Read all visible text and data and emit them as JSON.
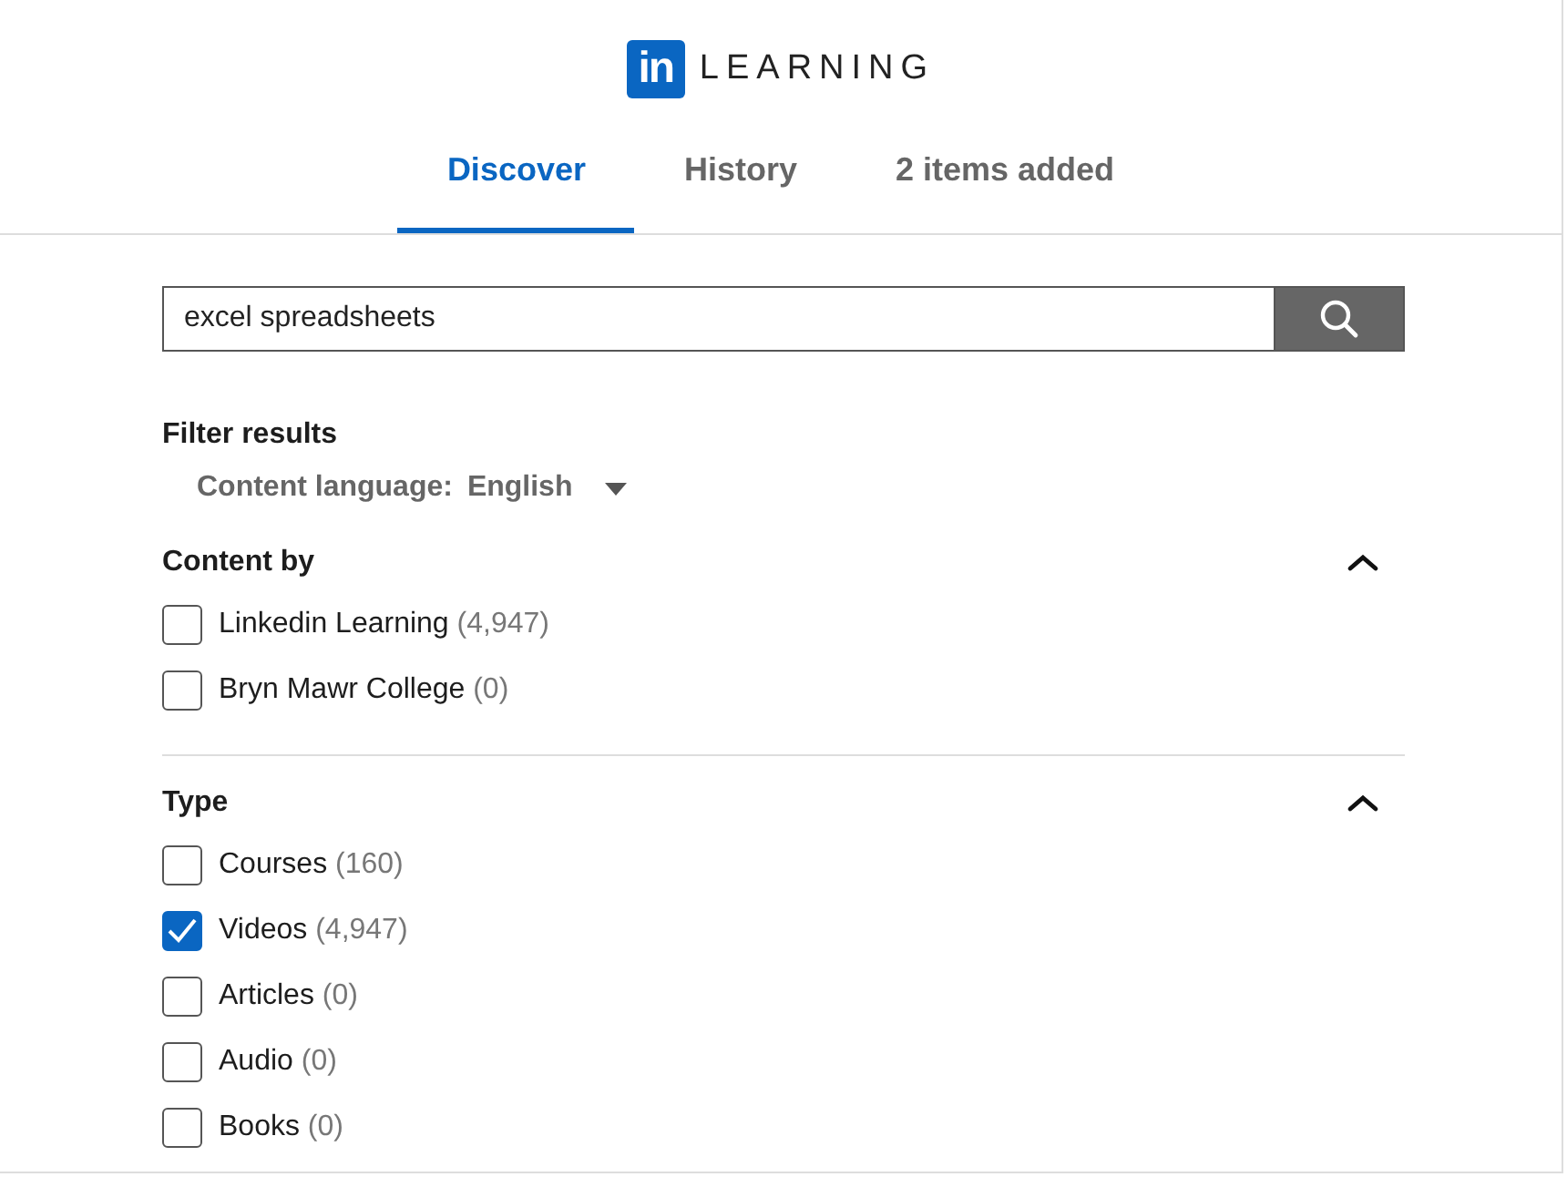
{
  "logo": {
    "mark": "in",
    "wordmark": "LEARNING"
  },
  "tabs": [
    {
      "label": "Discover",
      "selected": true
    },
    {
      "label": "History",
      "selected": false
    },
    {
      "label": "2 items added",
      "selected": false
    }
  ],
  "search": {
    "value": "excel spreadsheets"
  },
  "filters": {
    "title": "Filter results",
    "language_label": "Content language:",
    "language_value": "English"
  },
  "sections": [
    {
      "title": "Content by",
      "expanded": true,
      "options": [
        {
          "label": "Linkedin Learning",
          "count": "(4,947)",
          "checked": false
        },
        {
          "label": "Bryn Mawr College",
          "count": "(0)",
          "checked": false
        }
      ]
    },
    {
      "title": "Type",
      "expanded": true,
      "options": [
        {
          "label": "Courses",
          "count": "(160)",
          "checked": false
        },
        {
          "label": "Videos",
          "count": "(4,947)",
          "checked": true
        },
        {
          "label": "Articles",
          "count": "(0)",
          "checked": false
        },
        {
          "label": "Audio",
          "count": "(0)",
          "checked": false
        },
        {
          "label": "Books",
          "count": "(0)",
          "checked": false
        }
      ]
    }
  ]
}
